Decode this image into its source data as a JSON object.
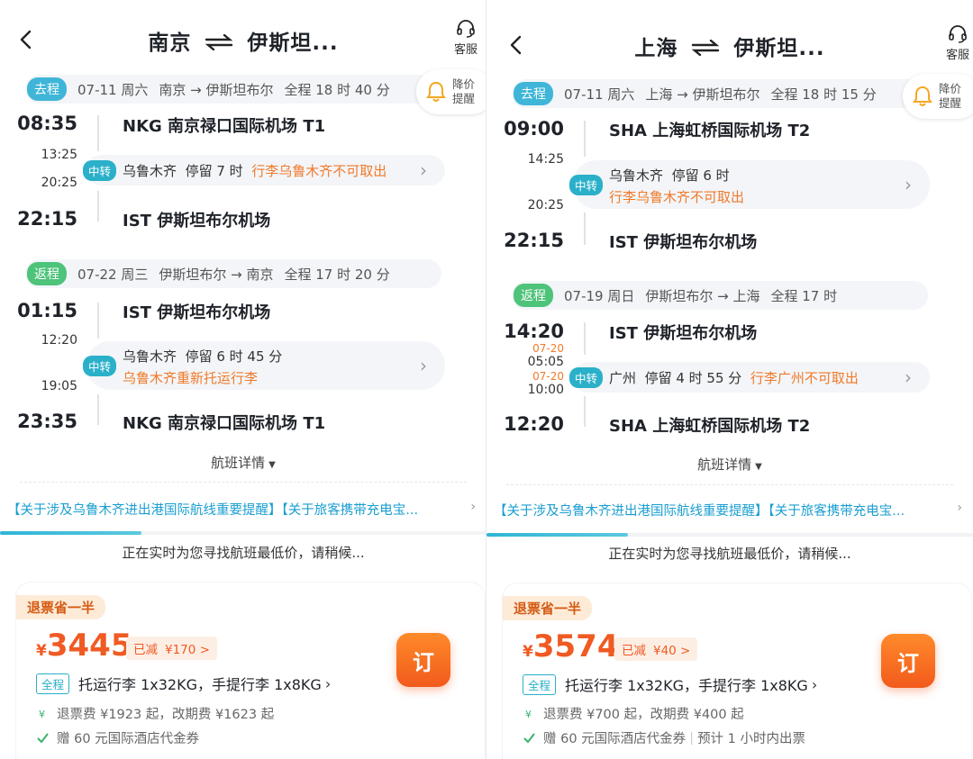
{
  "left": {
    "title_from": "南京",
    "title_to": "伊斯坦...",
    "customer_service": "客服",
    "price_alert": "降价提醒",
    "outbound": {
      "tag": "去程",
      "date": "07-11 周六",
      "route": "南京 → 伊斯坦布尔",
      "duration": "全程 18 时 40 分",
      "dep_time": "08:35",
      "dep_airport": "NKG 南京禄口国际机场 T1",
      "arr1": "13:25",
      "dep2": "20:25",
      "transfer_tag": "中转",
      "transfer_city": "乌鲁木齐",
      "stop": "停留 7 时",
      "warn": "行李乌鲁木齐不可取出",
      "arr_time": "22:15",
      "arr_airport": "IST 伊斯坦布尔机场"
    },
    "return": {
      "tag": "返程",
      "date": "07-22 周三",
      "route": "伊斯坦布尔 → 南京",
      "duration": "全程 17 时 20 分",
      "dep_time": "01:15",
      "dep_airport": "IST 伊斯坦布尔机场",
      "arr1": "12:20",
      "dep2": "19:05",
      "transfer_tag": "中转",
      "transfer_city": "乌鲁木齐",
      "stop": "停留 6 时 45 分",
      "warn": "乌鲁木齐重新托运行李",
      "arr_time": "23:35",
      "arr_airport": "NKG 南京禄口国际机场 T1"
    },
    "details": "航班详情",
    "notice": "【关于涉及乌鲁木齐进出港国际航线重要提醒】【关于旅客携带充电宝...",
    "searching": "正在实时为您寻找航班最低价，请稍候...",
    "progress": 0.29,
    "card": {
      "save_tag": "退票省一半",
      "currency": "¥",
      "price": "3445",
      "discount_label": "已减",
      "discount_amount": "¥170 >",
      "book": "订",
      "full_tag": "全程",
      "baggage": "托运行李 1x32KG，手提行李 1x8KG",
      "refund": "退票费 ¥1923 起，改期费 ¥1623 起",
      "voucher": "赠 60 元国际酒店代金券"
    }
  },
  "right": {
    "title_from": "上海",
    "title_to": "伊斯坦...",
    "customer_service": "客服",
    "price_alert": "降价提醒",
    "outbound": {
      "tag": "去程",
      "date": "07-11 周六",
      "route": "上海 → 伊斯坦布尔",
      "duration": "全程 18 时 15 分",
      "dep_time": "09:00",
      "dep_airport": "SHA 上海虹桥国际机场 T2",
      "arr1": "14:25",
      "dep2": "20:25",
      "transfer_tag": "中转",
      "transfer_city": "乌鲁木齐",
      "stop": "停留 6 时",
      "warn": "行李乌鲁木齐不可取出",
      "arr_time": "22:15",
      "arr_airport": "IST 伊斯坦布尔机场"
    },
    "return": {
      "tag": "返程",
      "date": "07-19 周日",
      "route": "伊斯坦布尔 → 上海",
      "duration": "全程 17 时",
      "dep_time": "14:20",
      "dep_airport": "IST 伊斯坦布尔机场",
      "arr1_date": "07-20",
      "arr1": "05:05",
      "dep2_date": "07-20",
      "dep2": "10:00",
      "transfer_tag": "中转",
      "transfer_city": "广州",
      "stop": "停留 4 时 55 分",
      "warn": "行李广州不可取出",
      "arr_time": "12:20",
      "arr_airport": "SHA 上海虹桥国际机场 T2"
    },
    "details": "航班详情",
    "notice": "【关于涉及乌鲁木齐进出港国际航线重要提醒】【关于旅客携带充电宝...",
    "searching": "正在实时为您寻找航班最低价，请稍候...",
    "progress": 0.29,
    "card": {
      "save_tag": "退票省一半",
      "currency": "¥",
      "price": "3574",
      "discount_label": "已减",
      "discount_amount": "¥40 >",
      "book": "订",
      "full_tag": "全程",
      "baggage": "托运行李 1x32KG，手提行李 1x8KG",
      "refund": "退票费 ¥700 起，改期费 ¥400 起",
      "voucher": "赠 60 元国际酒店代金券",
      "ticketing": "预计 1 小时内出票"
    }
  },
  "colors": {
    "accent": "#2ab0c9",
    "orange": "#f07a2a",
    "price": "#f05a23",
    "green_tag": "#4ec37a"
  }
}
